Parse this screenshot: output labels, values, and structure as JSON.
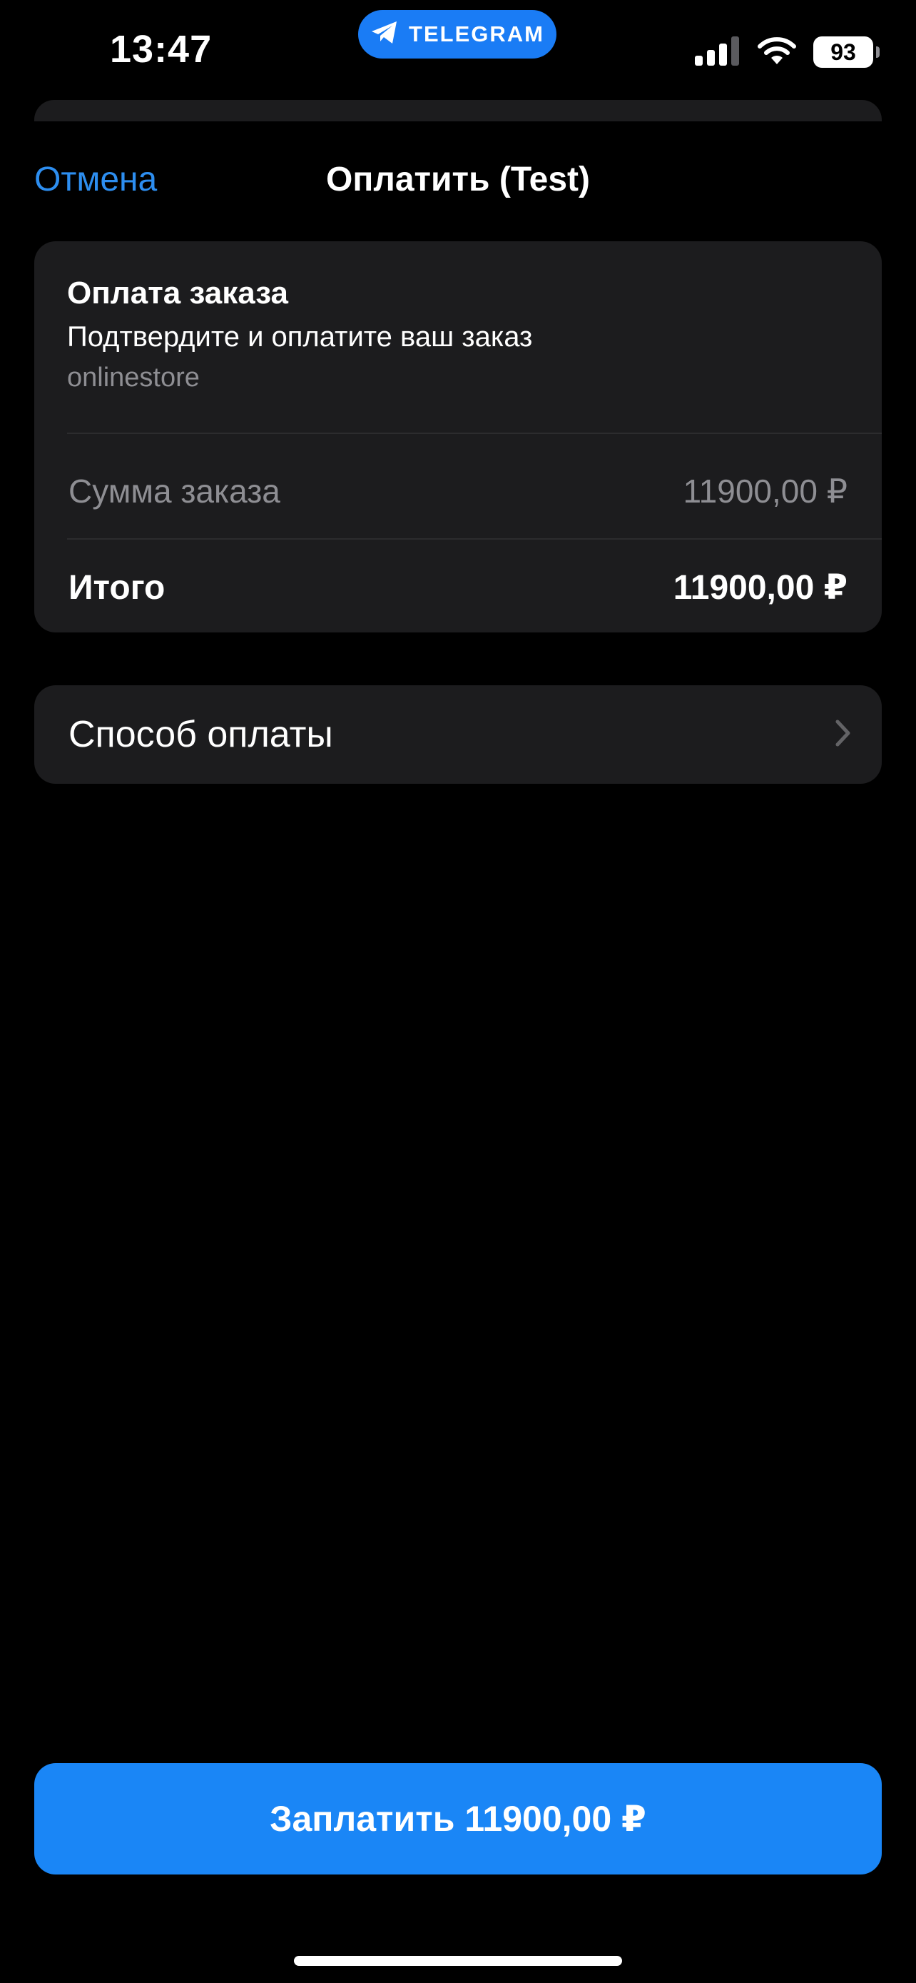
{
  "status_bar": {
    "time": "13:47",
    "app_pill": "TELEGRAM",
    "battery": "93"
  },
  "nav": {
    "cancel": "Отмена",
    "title": "Оплатить (Test)"
  },
  "order": {
    "title": "Оплата заказа",
    "description": "Подтвердите и оплатите ваш заказ",
    "store": "onlinestore",
    "sum_label": "Сумма заказа",
    "sum_value": "11900,00 ₽",
    "total_label": "Итого",
    "total_value": "11900,00 ₽"
  },
  "payment_method": {
    "label": "Способ оплаты"
  },
  "pay_button": {
    "label": "Заплатить 11900,00 ₽"
  },
  "colors": {
    "accent": "#1a86f6",
    "link": "#2d8ef0",
    "card": "#1c1c1e",
    "secondary_text": "#8e8e93"
  }
}
